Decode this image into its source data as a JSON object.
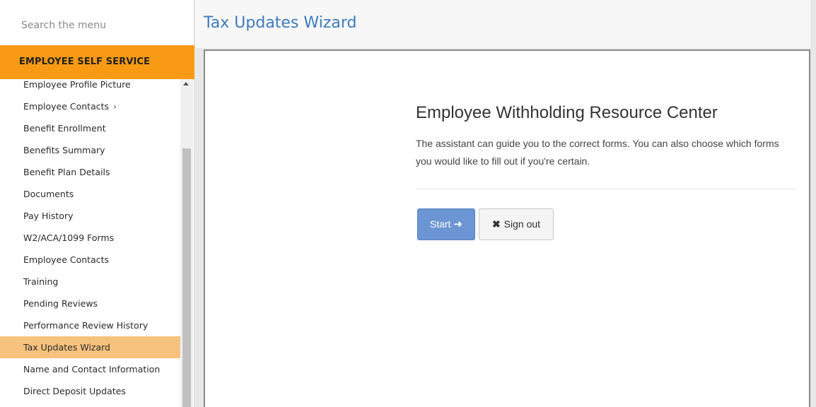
{
  "sidebar": {
    "search_placeholder": "Search the menu",
    "section_header": "EMPLOYEE SELF SERVICE",
    "items": [
      {
        "label": "Employee Profile Picture"
      },
      {
        "label": "Employee Contacts",
        "chevron": "›"
      },
      {
        "label": "Benefit Enrollment"
      },
      {
        "label": "Benefits Summary"
      },
      {
        "label": "Benefit Plan Details"
      },
      {
        "label": "Documents"
      },
      {
        "label": "Pay History"
      },
      {
        "label": "W2/ACA/1099 Forms"
      },
      {
        "label": "Employee Contacts"
      },
      {
        "label": "Training"
      },
      {
        "label": "Pending Reviews"
      },
      {
        "label": "Performance Review History"
      },
      {
        "label": "Tax Updates Wizard",
        "active": true
      },
      {
        "label": "Name and Contact Information"
      },
      {
        "label": "Direct Deposit Updates"
      }
    ]
  },
  "page": {
    "title": "Tax Updates Wizard"
  },
  "resource_center": {
    "title": "Employee Withholding Resource Center",
    "description": "The assistant can guide you to the correct forms. You can also choose which forms you would like to fill out if you're certain.",
    "start_label": "Start",
    "signout_label": "Sign out"
  },
  "icons": {
    "start_arrow": "arrow-right-icon",
    "signout": "close-icon",
    "chevron": "chevron-right-icon"
  },
  "colors": {
    "accent": "#f89a14",
    "active_item": "#f7c27d",
    "title_blue": "#3d7bbf",
    "primary_button": "#6b95d3"
  }
}
